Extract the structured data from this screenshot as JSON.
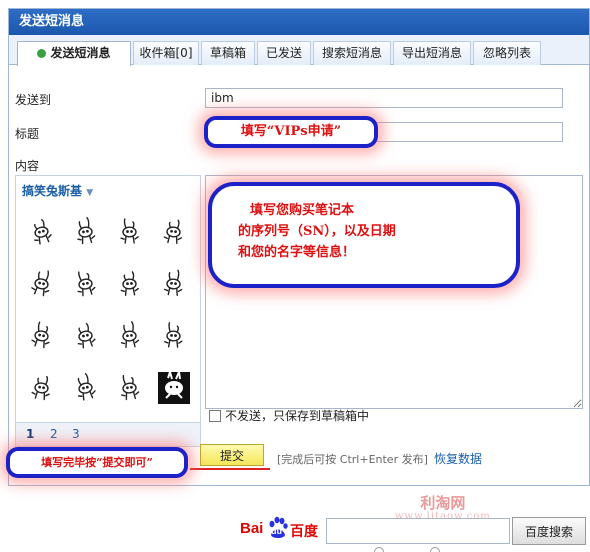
{
  "window": {
    "title": "发送短消息"
  },
  "tabs": [
    {
      "label": "发送短消息",
      "active": true
    },
    {
      "label": "收件箱[0]",
      "active": false
    },
    {
      "label": "草稿箱",
      "active": false
    },
    {
      "label": "已发送",
      "active": false
    },
    {
      "label": "搜索短消息",
      "active": false
    },
    {
      "label": "导出短消息",
      "active": false
    },
    {
      "label": "忽略列表",
      "active": false
    }
  ],
  "form": {
    "to_label": "发送到",
    "to_value": "ibm",
    "subject_label": "标题",
    "subject_value": "",
    "content_label": "内容",
    "content_value": ""
  },
  "emoticons": {
    "category": "搞笑兔斯基",
    "pages": [
      "1",
      "2",
      "3"
    ],
    "current_page": "1",
    "count": 16
  },
  "draft_option": {
    "label": "不发送，只保存到草稿箱中",
    "checked": false
  },
  "actions": {
    "submit_label": "提交",
    "hint": "[完成后可按 Ctrl+Enter 发布]",
    "restore_label": "恢复数据"
  },
  "annotations": {
    "title_note": "填写“VIPs申请”",
    "content_note_lines": [
      "填写您购买笔记本",
      "的序列号（SN），以及日期",
      "和您的名字等信息！"
    ],
    "submit_note": "填写完毕按“提交即可”"
  },
  "watermark": {
    "line1": "利淘网",
    "line2": "www.litaow.com"
  },
  "baidu": {
    "logo_text_left": "Bai",
    "logo_text_mid": "du",
    "logo_text_right": "百度",
    "button_label": "百度搜索"
  },
  "colors": {
    "titlebar": "#1b57ad",
    "callout_border": "#1c22c8",
    "callout_text": "#dd1111",
    "submit_bg": "#f4e65a"
  }
}
